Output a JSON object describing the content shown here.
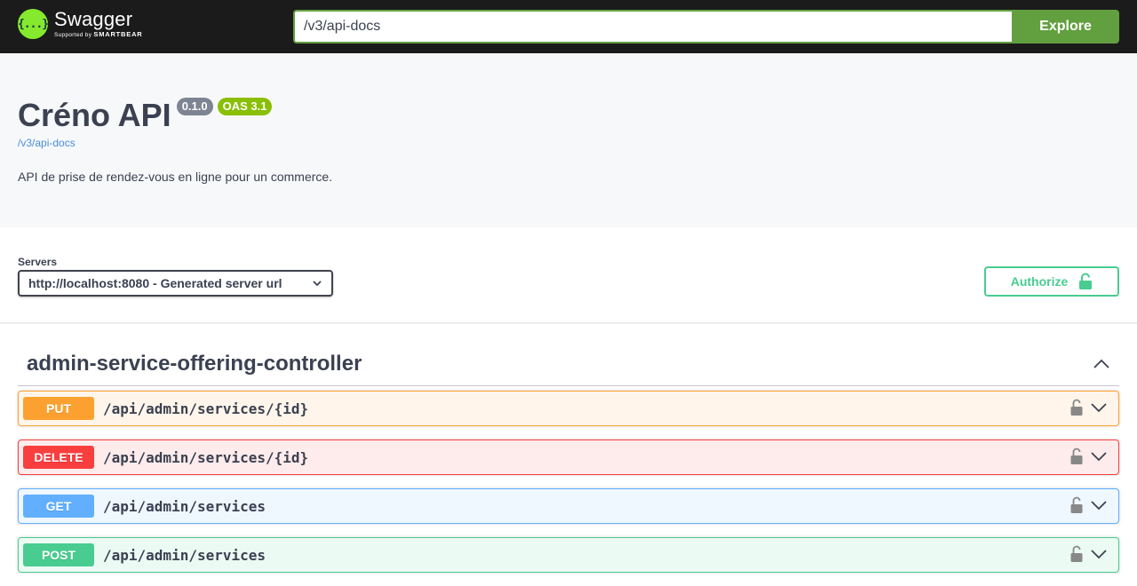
{
  "topbar": {
    "logo_mark": "{...}",
    "logo_name": "Swagger",
    "logo_sub_prefix": "Supported by",
    "logo_sub_brand": "SMARTBEAR",
    "url_value": "/v3/api-docs",
    "explore_label": "Explore",
    "accent_color": "#85ea2d",
    "explore_color": "#62a03f"
  },
  "info": {
    "title": "Créno API",
    "version_badge": "0.1.0",
    "oas_badge": "OAS 3.1",
    "spec_link": "/v3/api-docs",
    "description": "API de prise de rendez-vous en ligne pour un commerce."
  },
  "schemes": {
    "servers_label": "Servers",
    "selected_server": "http://localhost:8080 - Generated server url",
    "authorize_label": "Authorize",
    "authorize_icon": "unlocked-lock-icon"
  },
  "tag": {
    "name": "admin-service-offering-controller",
    "expanded": true,
    "operations": [
      {
        "method": "PUT",
        "path": "/api/admin/services/{id}",
        "color": "#fca130"
      },
      {
        "method": "DELETE",
        "path": "/api/admin/services/{id}",
        "color": "#f93e3e"
      },
      {
        "method": "GET",
        "path": "/api/admin/services",
        "color": "#61affe"
      },
      {
        "method": "POST",
        "path": "/api/admin/services",
        "color": "#49cc90"
      }
    ]
  }
}
